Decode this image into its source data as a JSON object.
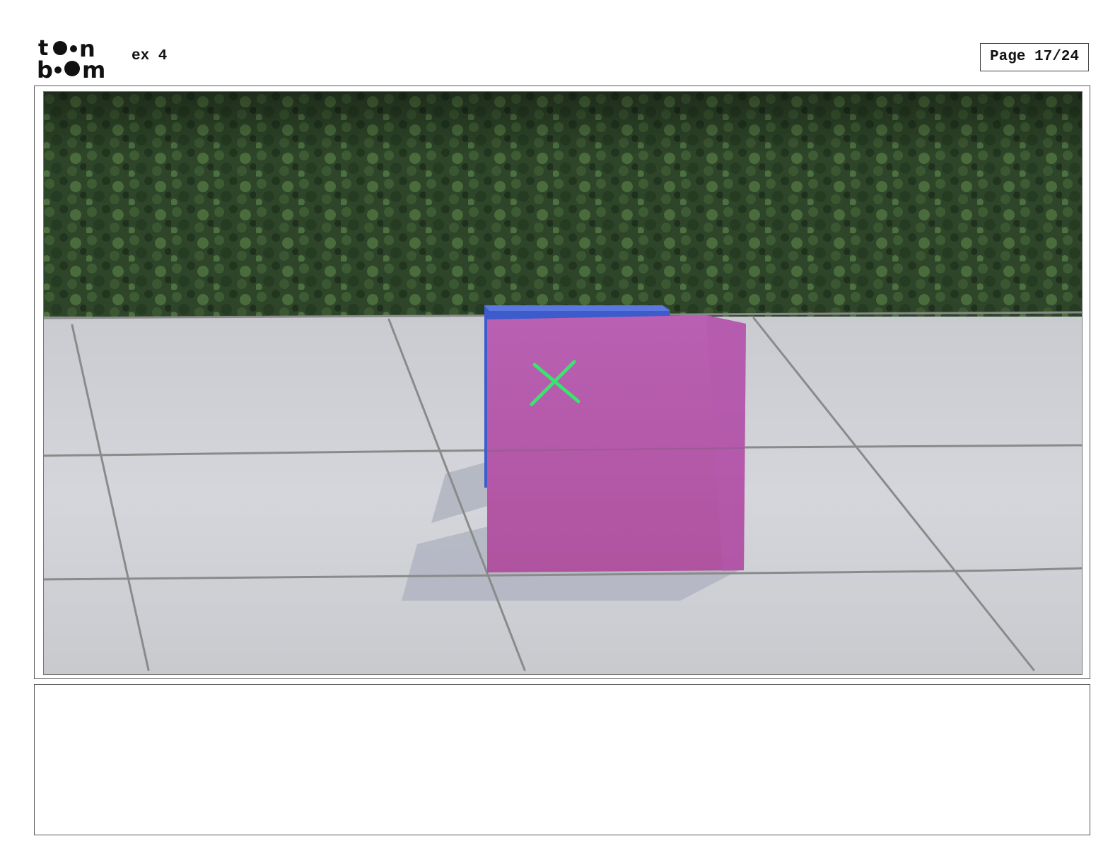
{
  "header": {
    "logo_text_line1": "toon",
    "logo_text_line2": "boom",
    "project_title": "ex 4",
    "page_label": "Page 17/24"
  },
  "panel": {
    "image_description_icon": "storyboard-panel-image",
    "annotation_mark": "X",
    "colors": {
      "foliage": "#2f4a2b",
      "floor": "#cfd1d6",
      "grid_lines": "#8c8c8c",
      "magenta_cube": "#b55db0",
      "blue_cube": "#3f5fcf",
      "annotation": "#33e36a"
    }
  },
  "notes": {
    "text": ""
  }
}
